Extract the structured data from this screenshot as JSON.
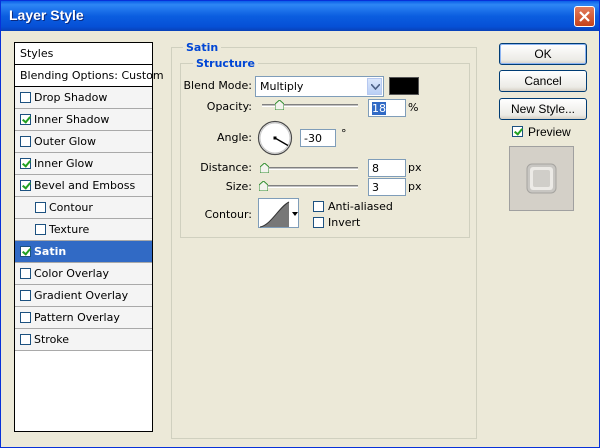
{
  "window": {
    "title": "Layer Style"
  },
  "styles_panel": {
    "header": "Styles",
    "blending": "Blending Options: Custom",
    "items": [
      {
        "label": "Drop Shadow",
        "checked": false,
        "sub": false
      },
      {
        "label": "Inner Shadow",
        "checked": true,
        "sub": false
      },
      {
        "label": "Outer Glow",
        "checked": false,
        "sub": false
      },
      {
        "label": "Inner Glow",
        "checked": true,
        "sub": false
      },
      {
        "label": "Bevel and Emboss",
        "checked": true,
        "sub": false
      },
      {
        "label": "Contour",
        "checked": false,
        "sub": true
      },
      {
        "label": "Texture",
        "checked": false,
        "sub": true
      },
      {
        "label": "Satin",
        "checked": true,
        "sub": false,
        "selected": true
      },
      {
        "label": "Color Overlay",
        "checked": false,
        "sub": false
      },
      {
        "label": "Gradient Overlay",
        "checked": false,
        "sub": false
      },
      {
        "label": "Pattern Overlay",
        "checked": false,
        "sub": false
      },
      {
        "label": "Stroke",
        "checked": false,
        "sub": false
      }
    ]
  },
  "satin": {
    "group_title": "Satin",
    "structure_title": "Structure",
    "blend_mode_label": "Blend Mode:",
    "blend_mode_value": "Multiply",
    "blend_color": "#000000",
    "opacity_label": "Opacity:",
    "opacity_value": "18",
    "opacity_unit": "%",
    "opacity_slider": 0.18,
    "angle_label": "Angle:",
    "angle_value": "-30",
    "angle_unit": "°",
    "distance_label": "Distance:",
    "distance_value": "8",
    "distance_unit": "px",
    "distance_slider": 0.03,
    "size_label": "Size:",
    "size_value": "3",
    "size_unit": "px",
    "size_slider": 0.02,
    "contour_label": "Contour:",
    "anti_aliased_label": "Anti-aliased",
    "anti_aliased_checked": false,
    "invert_label": "Invert",
    "invert_checked": false
  },
  "buttons": {
    "ok": "OK",
    "cancel": "Cancel",
    "new_style": "New Style...",
    "preview_label": "Preview",
    "preview_checked": true
  }
}
